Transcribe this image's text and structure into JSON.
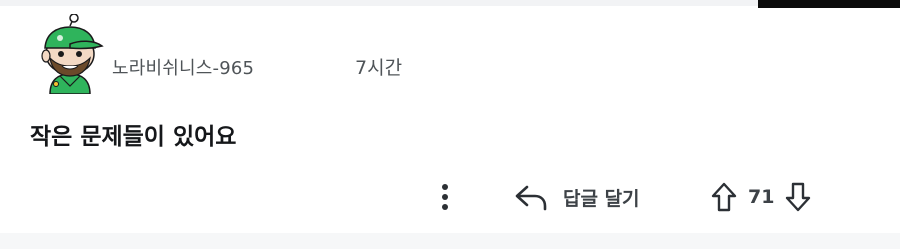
{
  "comment": {
    "author": "노라비쉬니스-965",
    "time": "7시간",
    "text": "작은 문제들이 있어요",
    "avatar_icon": "snoo-avatar-green-cap"
  },
  "actions": {
    "more_icon": "more-vertical-icon",
    "reply_icon": "reply-arrow-icon",
    "reply_label": "답글 달기",
    "upvote_icon": "upvote-arrow-icon",
    "downvote_icon": "downvote-arrow-icon",
    "vote_count": "71"
  },
  "colors": {
    "text_primary": "#15171a",
    "text_secondary": "#4f5458",
    "action_text": "#3d4247",
    "avatar_green": "#2fb45c"
  }
}
